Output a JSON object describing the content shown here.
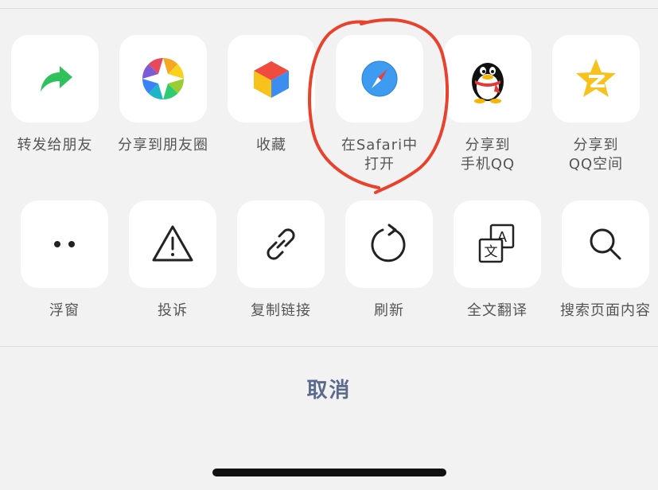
{
  "share_row": [
    {
      "label": [
        "转发给朋友"
      ],
      "icon": "forward-arrow-icon"
    },
    {
      "label": [
        "分享到朋友圈"
      ],
      "icon": "moments-aperture-icon"
    },
    {
      "label": [
        "收藏"
      ],
      "icon": "favorites-cube-icon"
    },
    {
      "label": [
        "在Safari中",
        "打开"
      ],
      "icon": "safari-compass-icon"
    },
    {
      "label": [
        "分享到",
        "手机QQ"
      ],
      "icon": "qq-penguin-icon"
    },
    {
      "label": [
        "分享到",
        "QQ空间"
      ],
      "icon": "qzone-star-icon"
    }
  ],
  "action_row": [
    {
      "label": "浮窗",
      "icon": "floating-window-dots-icon"
    },
    {
      "label": "投诉",
      "icon": "warning-triangle-icon"
    },
    {
      "label": "复制链接",
      "icon": "link-icon"
    },
    {
      "label": "刷新",
      "icon": "refresh-icon"
    },
    {
      "label": "全文翻译",
      "icon": "translate-icon"
    },
    {
      "label": "搜索页面内容",
      "icon": "search-icon"
    }
  ],
  "cancel_label": "取消",
  "colors": {
    "background": "#f2f2f2",
    "tile": "#ffffff",
    "label_text": "#555555",
    "cancel_text": "#5b6b8c",
    "annotation_circle": "#e8412c"
  }
}
